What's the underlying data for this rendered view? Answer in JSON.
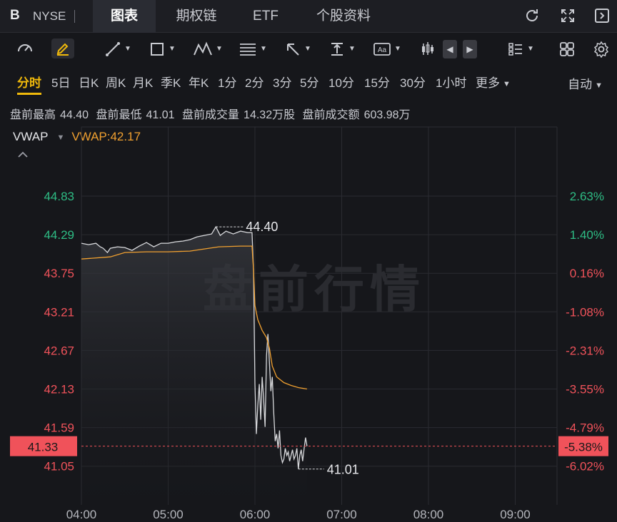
{
  "header": {
    "ticker": "B",
    "exchange": "NYSE",
    "tabs": [
      {
        "label": "图表",
        "active": true
      },
      {
        "label": "期权链",
        "active": false
      },
      {
        "label": "ETF",
        "active": false
      },
      {
        "label": "个股资料",
        "active": false
      }
    ],
    "icons": [
      "refresh-icon",
      "fullscreen-icon",
      "collapse-panel-icon"
    ]
  },
  "toolbar": {
    "tools": [
      "gauge-icon",
      "pen-icon",
      "line-tool-icon",
      "rectangle-tool-icon",
      "pattern-tool-icon",
      "fib-tool-icon",
      "arrow-tool-icon",
      "price-range-icon",
      "text-tool-icon",
      "candle-type-icon",
      "prev-icon",
      "next-icon",
      "list-icon",
      "grid-icon",
      "settings-icon"
    ]
  },
  "periods": {
    "items": [
      "分时",
      "5日",
      "日K",
      "周K",
      "月K",
      "季K",
      "年K",
      "1分",
      "2分",
      "3分",
      "5分",
      "10分",
      "15分",
      "30分",
      "1小时",
      "更多"
    ],
    "active": "分时",
    "mode": "自动"
  },
  "stats": {
    "items": [
      "盘前最高",
      "44.40",
      "盘前最低",
      "41.01",
      "盘前成交量",
      "14.32万股",
      "盘前成交额",
      "603.98万"
    ]
  },
  "indicator": {
    "name": "VWAP",
    "value_label": "VWAP:42.17"
  },
  "chart_data": {
    "type": "line",
    "watermark": "盘前行情",
    "x_ticks": [
      "04:00",
      "05:00",
      "06:00",
      "07:00",
      "08:00",
      "09:00"
    ],
    "y_ticks_left": [
      "44.83",
      "44.29",
      "43.75",
      "43.21",
      "42.67",
      "42.13",
      "41.59",
      "41.05"
    ],
    "y_ticks_right": [
      "2.63%",
      "1.40%",
      "0.16%",
      "-1.08%",
      "-2.31%",
      "-3.55%",
      "-4.79%",
      "-6.02%"
    ],
    "ylim": [
      40.8,
      45.3
    ],
    "prev_close": 44.2,
    "current_price": "41.33",
    "current_pct": "-5.38%",
    "high_label": "44.40",
    "low_label": "41.01",
    "colors": {
      "up": "#2ebd85",
      "down": "#f0525a",
      "price": "#d8d9dc",
      "vwap": "#f0a030"
    },
    "series": [
      {
        "name": "price",
        "points": [
          [
            "04:00",
            44.17
          ],
          [
            "04:05",
            44.15
          ],
          [
            "04:10",
            44.17
          ],
          [
            "04:13",
            44.12
          ],
          [
            "04:15",
            44.1
          ],
          [
            "04:18",
            44.04
          ],
          [
            "04:20",
            44.1
          ],
          [
            "04:25",
            44.12
          ],
          [
            "04:30",
            44.11
          ],
          [
            "04:35",
            44.07
          ],
          [
            "04:40",
            44.13
          ],
          [
            "04:45",
            44.18
          ],
          [
            "04:50",
            44.12
          ],
          [
            "04:55",
            44.17
          ],
          [
            "05:00",
            44.17
          ],
          [
            "05:05",
            44.19
          ],
          [
            "05:10",
            44.2
          ],
          [
            "05:15",
            44.22
          ],
          [
            "05:20",
            44.26
          ],
          [
            "05:25",
            44.28
          ],
          [
            "05:30",
            44.3
          ],
          [
            "05:33",
            44.4
          ],
          [
            "05:36",
            44.28
          ],
          [
            "05:40",
            44.34
          ],
          [
            "05:45",
            44.3
          ],
          [
            "05:50",
            44.34
          ],
          [
            "05:55",
            44.32
          ],
          [
            "05:58",
            44.32
          ],
          [
            "05:59",
            43.8
          ],
          [
            "06:00",
            42.2
          ],
          [
            "06:01",
            41.5
          ],
          [
            "06:02",
            41.9
          ],
          [
            "06:03",
            42.2
          ],
          [
            "06:04",
            41.7
          ],
          [
            "06:05",
            42.3
          ],
          [
            "06:06",
            42.0
          ],
          [
            "06:07",
            41.6
          ],
          [
            "06:08",
            42.6
          ],
          [
            "06:09",
            42.9
          ],
          [
            "06:10",
            42.5
          ],
          [
            "06:11",
            42.1
          ],
          [
            "06:12",
            42.3
          ],
          [
            "06:13",
            41.8
          ],
          [
            "06:14",
            41.4
          ],
          [
            "06:15",
            41.5
          ],
          [
            "06:16",
            41.3
          ],
          [
            "06:17",
            41.55
          ],
          [
            "06:18",
            41.2
          ],
          [
            "06:19",
            41.1
          ],
          [
            "06:20",
            41.15
          ],
          [
            "06:21",
            41.3
          ],
          [
            "06:22",
            41.2
          ],
          [
            "06:23",
            41.25
          ],
          [
            "06:24",
            41.12
          ],
          [
            "06:25",
            41.2
          ],
          [
            "06:26",
            41.28
          ],
          [
            "06:27",
            41.15
          ],
          [
            "06:28",
            41.2
          ],
          [
            "06:29",
            41.3
          ],
          [
            "06:30",
            41.01
          ],
          [
            "06:31",
            41.2
          ],
          [
            "06:32",
            41.28
          ],
          [
            "06:33",
            41.12
          ],
          [
            "06:34",
            41.3
          ],
          [
            "06:35",
            41.45
          ],
          [
            "06:36",
            41.33
          ]
        ]
      },
      {
        "name": "VWAP",
        "points": [
          [
            "04:00",
            43.95
          ],
          [
            "04:20",
            43.98
          ],
          [
            "04:30",
            44.04
          ],
          [
            "04:45",
            44.05
          ],
          [
            "05:00",
            44.05
          ],
          [
            "05:15",
            44.06
          ],
          [
            "05:25",
            44.09
          ],
          [
            "05:35",
            44.12
          ],
          [
            "05:50",
            44.13
          ],
          [
            "05:58",
            44.13
          ],
          [
            "05:59",
            43.8
          ],
          [
            "06:00",
            43.3
          ],
          [
            "06:02",
            43.1
          ],
          [
            "06:05",
            42.95
          ],
          [
            "06:08",
            42.85
          ],
          [
            "06:10",
            42.7
          ],
          [
            "06:12",
            42.45
          ],
          [
            "06:15",
            42.3
          ],
          [
            "06:20",
            42.22
          ],
          [
            "06:25",
            42.18
          ],
          [
            "06:30",
            42.15
          ],
          [
            "06:36",
            42.13
          ]
        ]
      }
    ]
  }
}
